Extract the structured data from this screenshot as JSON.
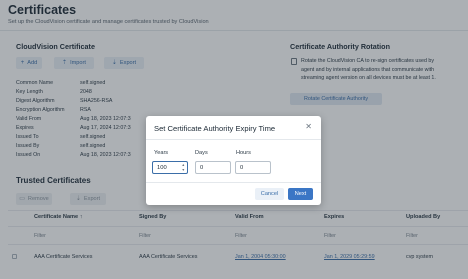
{
  "page": {
    "title": "Certificates",
    "subtitle": "Set up the CloudVision certificate and manage certificates trusted by CloudVision"
  },
  "cloudvision_cert": {
    "title": "CloudVision Certificate",
    "add_label": "Add",
    "import_label": "Import",
    "export_label": "Export",
    "fields": [
      {
        "key": "Common Name",
        "value": "self.signed"
      },
      {
        "key": "Key Length",
        "value": "2048"
      },
      {
        "key": "Digest Algorithm",
        "value": "SHA256-RSA"
      },
      {
        "key": "Encryption Algorithm",
        "value": "RSA"
      },
      {
        "key": "Valid From",
        "value": "Aug 18, 2023 12:07:3"
      },
      {
        "key": "Expires",
        "value": "Aug 17, 2024 12:07:3"
      },
      {
        "key": "Issued To",
        "value": "self.signed"
      },
      {
        "key": "Issued By",
        "value": "self.signed"
      },
      {
        "key": "Issued On",
        "value": "Aug 18, 2023 12:07:3"
      }
    ]
  },
  "ca_rotation": {
    "title": "Certificate Authority Rotation",
    "description_lines": [
      "Rotate the CloudVision CA to re-sign certificates used by",
      "agent and by internal applications that communicate with",
      "streaming agent version on all devices must be at least 1."
    ],
    "rotate_label": "Rotate Certificate Authority"
  },
  "trusted": {
    "title": "Trusted Certificates",
    "remove_label": "Remove",
    "export_label": "Export",
    "columns": [
      "Certificate Name",
      "Signed By",
      "Valid From",
      "Expires",
      "Uploaded By"
    ],
    "sort_indicator": "↑",
    "filter_placeholder": "Filter",
    "rows": [
      {
        "name": "AAA Certificate Services",
        "signed_by": "AAA Certificate Services",
        "valid_from": "Jan 1, 2004 05:30:00",
        "expires": "Jan 1, 2029 05:29:59",
        "uploaded_by": "cvp system"
      }
    ]
  },
  "modal": {
    "title": "Set Certificate Authority Expiry Time",
    "close_symbol": "✕",
    "years_label": "Years",
    "years_value": "100",
    "days_label": "Days",
    "days_value": "0",
    "hours_label": "Hours",
    "hours_value": "0",
    "cancel_label": "Cancel",
    "next_label": "Next"
  },
  "colors": {
    "accent": "#3b76c5",
    "link": "#3b6ea8",
    "overlay": "rgba(38,48,58,0.38)"
  },
  "icons": [
    "plus-icon",
    "import-icon",
    "export-icon",
    "info-icon",
    "remove-icon",
    "close-icon",
    "spinner-icon"
  ]
}
